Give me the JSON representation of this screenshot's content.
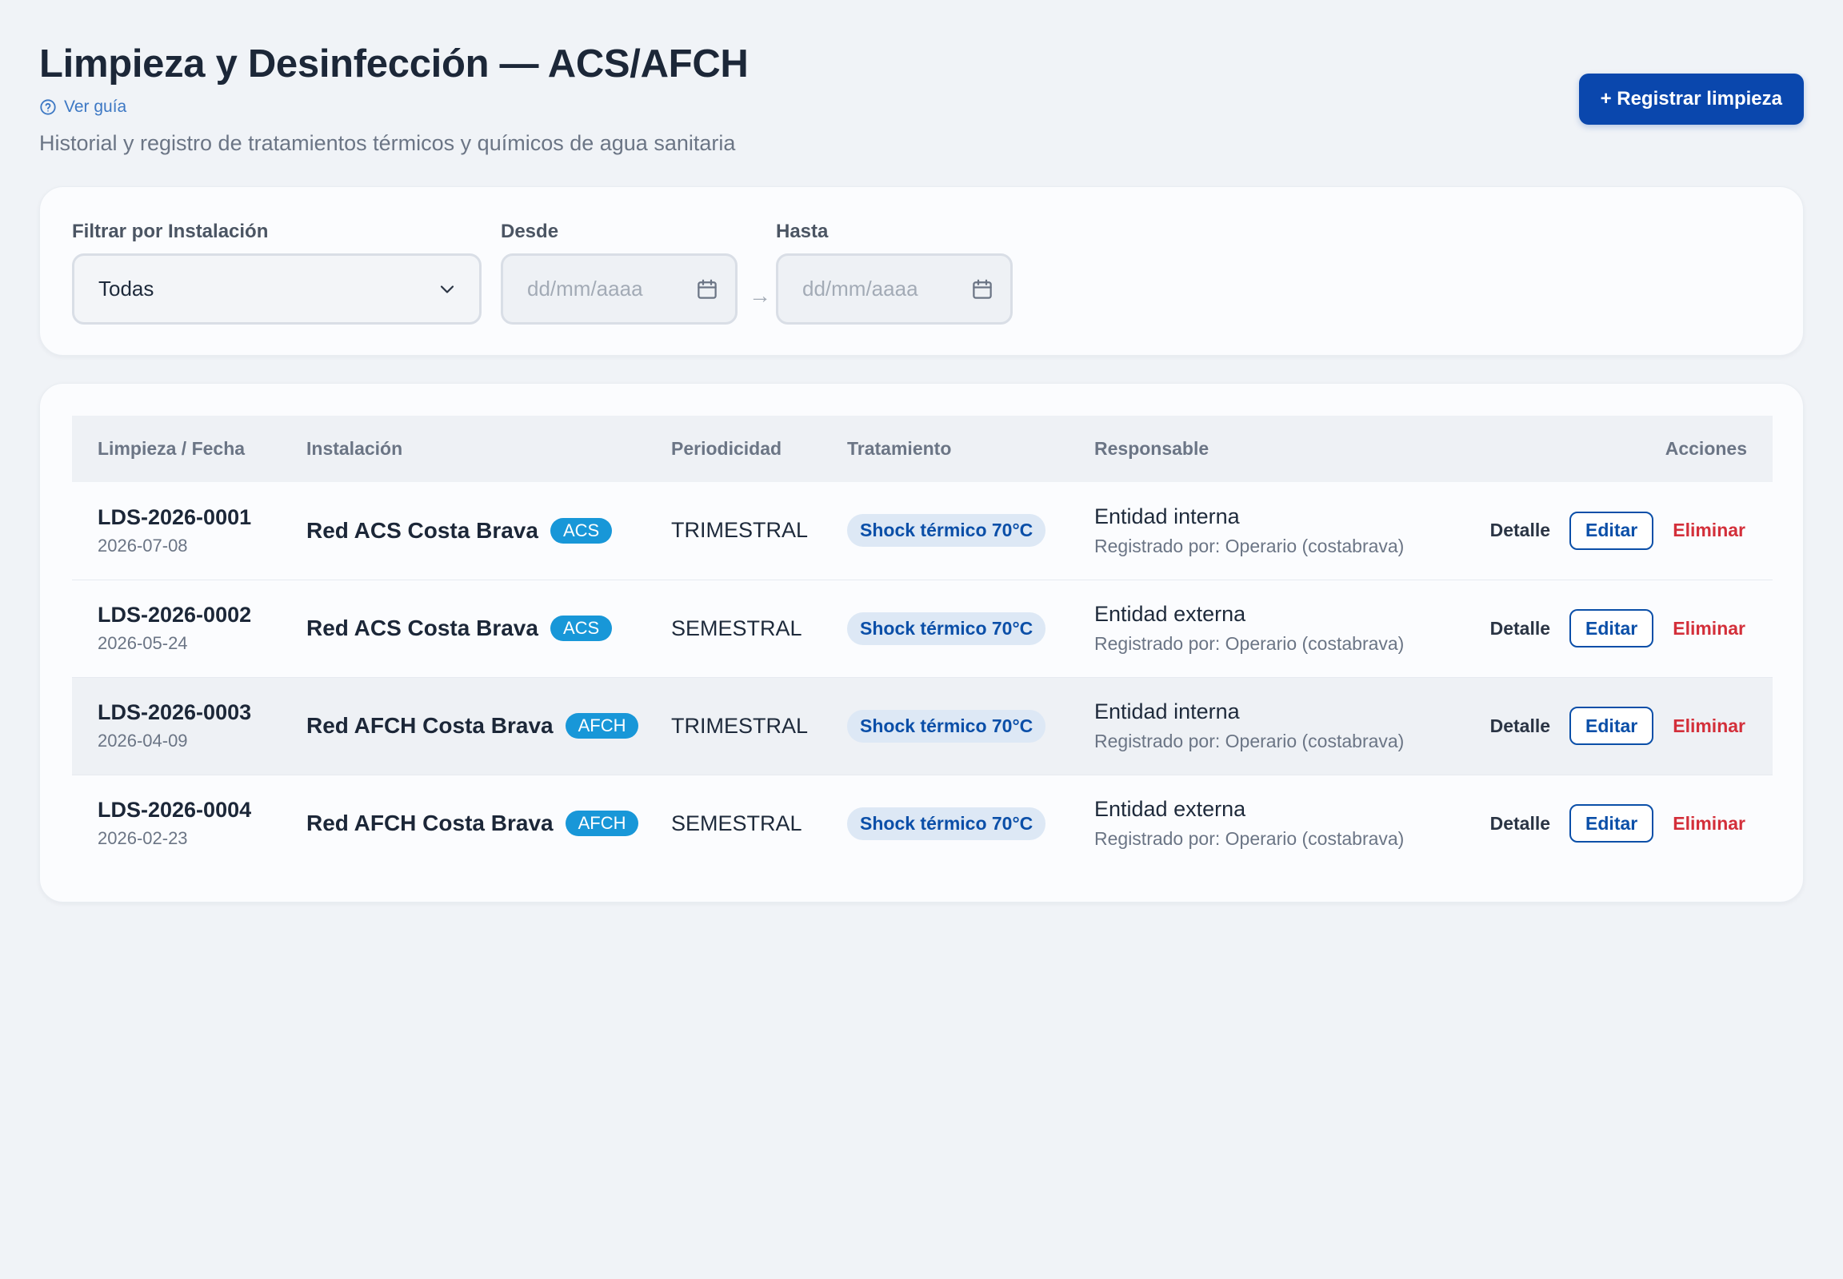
{
  "header": {
    "title": "Limpieza y Desinfección — ACS/AFCH",
    "guide_link": "Ver guía",
    "subtitle": "Historial y registro de tratamientos térmicos y químicos de agua sanitaria",
    "primary_button": "+ Registrar limpieza"
  },
  "filters": {
    "installation_label": "Filtrar por Instalación",
    "installation_value": "Todas",
    "from_label": "Desde",
    "from_placeholder": "dd/mm/aaaa",
    "to_label": "Hasta",
    "to_placeholder": "dd/mm/aaaa",
    "range_arrow": "→"
  },
  "table": {
    "columns": [
      "Limpieza / Fecha",
      "Instalación",
      "Periodicidad",
      "Tratamiento",
      "Responsable",
      "Acciones"
    ],
    "action_labels": {
      "detail": "Detalle",
      "edit": "Editar",
      "delete": "Eliminar"
    },
    "rows": [
      {
        "code": "LDS-2026-0001",
        "date": "2026-07-08",
        "installation": "Red ACS Costa Brava",
        "tag": "ACS",
        "period": "TRIMESTRAL",
        "treatment": "Shock térmico 70°C",
        "responsible": "Entidad interna",
        "registered_by": "Registrado por: Operario (costabrava)"
      },
      {
        "code": "LDS-2026-0002",
        "date": "2026-05-24",
        "installation": "Red ACS Costa Brava",
        "tag": "ACS",
        "period": "SEMESTRAL",
        "treatment": "Shock térmico 70°C",
        "responsible": "Entidad externa",
        "registered_by": "Registrado por: Operario (costabrava)"
      },
      {
        "code": "LDS-2026-0003",
        "date": "2026-04-09",
        "installation": "Red AFCH Costa Brava",
        "tag": "AFCH",
        "period": "TRIMESTRAL",
        "treatment": "Shock térmico 70°C",
        "responsible": "Entidad interna",
        "registered_by": "Registrado por: Operario (costabrava)"
      },
      {
        "code": "LDS-2026-0004",
        "date": "2026-02-23",
        "installation": "Red AFCH Costa Brava",
        "tag": "AFCH",
        "period": "SEMESTRAL",
        "treatment": "Shock térmico 70°C",
        "responsible": "Entidad externa",
        "registered_by": "Registrado por: Operario (costabrava)"
      }
    ]
  },
  "colors": {
    "primary": "#0a47ad",
    "tag": "#1897d8",
    "treatment_pill_bg": "#dde8f5",
    "danger": "#d32f3a",
    "background": "#f0f3f7"
  },
  "icons": [
    "help-circle-icon",
    "chevron-down-icon",
    "calendar-icon"
  ]
}
